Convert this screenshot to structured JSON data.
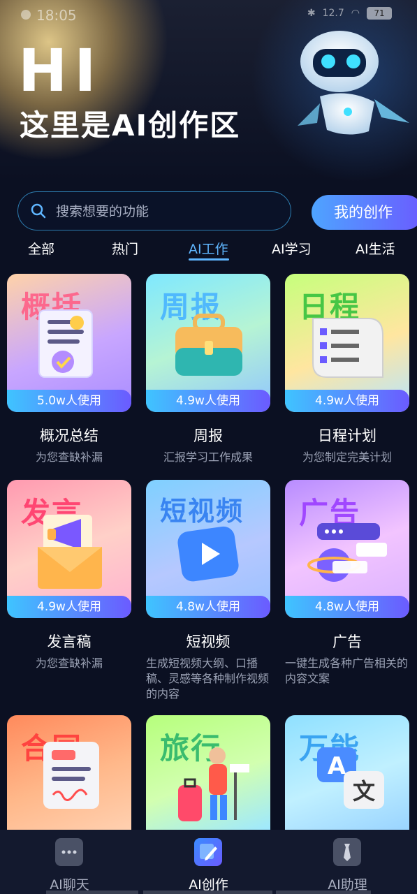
{
  "status_bar": {
    "time": "18:05",
    "battery": "71",
    "net": "12.7"
  },
  "hero": {
    "title": "HI",
    "subtitle": "这里是AI创作区"
  },
  "search": {
    "placeholder": "搜索想要的功能"
  },
  "my_creation_label": "我的创作",
  "tabs": [
    {
      "label": "全部"
    },
    {
      "label": "热门"
    },
    {
      "label": "AI工作"
    },
    {
      "label": "AI学习"
    },
    {
      "label": "AI生活"
    }
  ],
  "active_tab": 2,
  "cards": [
    {
      "art_text": "概括",
      "usage": "5.0w人使用",
      "title": "概况总结",
      "desc": "为您查缺补漏"
    },
    {
      "art_text": "周报",
      "usage": "4.9w人使用",
      "title": "周报",
      "desc": "汇报学习工作成果"
    },
    {
      "art_text": "日程",
      "usage": "4.9w人使用",
      "title": "日程计划",
      "desc": "为您制定完美计划"
    },
    {
      "art_text": "发言",
      "usage": "4.9w人使用",
      "title": "发言稿",
      "desc": "为您查缺补漏"
    },
    {
      "art_text": "短视频",
      "usage": "4.8w人使用",
      "title": "短视频",
      "desc": "生成短视频大纲、口播稿、灵感等各种制作视频的内容"
    },
    {
      "art_text": "广告",
      "usage": "4.8w人使用",
      "title": "广告",
      "desc": "一键生成各种广告相关的内容文案"
    },
    {
      "art_text": "合同",
      "usage": "",
      "title": "",
      "desc": ""
    },
    {
      "art_text": "旅行",
      "usage": "",
      "title": "",
      "desc": ""
    },
    {
      "art_text": "万能",
      "usage": "",
      "title": "",
      "desc": ""
    }
  ],
  "bottom_nav": [
    {
      "label": "AI聊天",
      "icon": "chat-icon"
    },
    {
      "label": "AI创作",
      "icon": "pen-icon"
    },
    {
      "label": "AI助理",
      "icon": "tie-icon"
    }
  ],
  "colors": {
    "accent": "#5fb6ff",
    "background": "#0b1022",
    "button_gradient": [
      "#4ea4ff",
      "#6a5cff"
    ]
  }
}
